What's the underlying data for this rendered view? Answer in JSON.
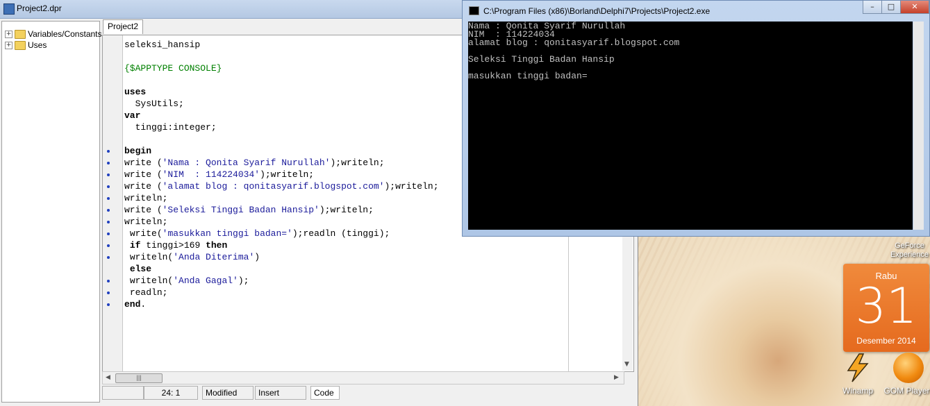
{
  "editor": {
    "title": "Project2.dpr",
    "tree": [
      {
        "toggle": "+",
        "label": "Variables/Constants"
      },
      {
        "toggle": "+",
        "label": "Uses"
      }
    ],
    "tab": "Project2",
    "code_lines": [
      "seleksi_hansip",
      "",
      "{$APPTYPE CONSOLE}",
      "",
      "uses",
      "  SysUtils;",
      "var",
      "  tinggi:integer;",
      "",
      "begin",
      "write ('Nama : Qonita Syarif Nurullah');writeln;",
      "write ('NIM  : 114224034');writeln;",
      "write ('alamat blog : qonitasyarif.blogspot.com');writeln;",
      "writeln;",
      "write ('Seleksi Tinggi Badan Hansip');writeln;",
      "writeln;",
      " write('masukkan tinggi badan=');readln (tinggi);",
      " if tinggi>169 then",
      " writeln('Anda Diterima')",
      " else",
      " writeln('Anda Gagal');",
      " readln;",
      "end."
    ],
    "hscroll_thumb": "|||",
    "status": {
      "position": "24:  1",
      "modified": "Modified",
      "mode": "Insert",
      "tab": "Code"
    }
  },
  "console": {
    "title": "C:\\Program Files (x86)\\Borland\\Delphi7\\Projects\\Project2.exe",
    "lines": [
      "Nama : Qonita Syarif Nurullah",
      "NIM  : 114224034",
      "alamat blog : qonitasyarif.blogspot.com",
      "",
      "Seleksi Tinggi Badan Hansip",
      "",
      "masukkan tinggi badan="
    ],
    "buttons": {
      "minimize": "–",
      "maximize": "□",
      "close": "✕"
    }
  },
  "desktop": {
    "calendar": {
      "day": "Rabu",
      "date": "31",
      "month": "Desember 2014"
    },
    "icons": [
      {
        "label": "GeForce Experience"
      },
      {
        "label": "Winamp"
      },
      {
        "label": "GOM Player"
      }
    ]
  },
  "colors": {
    "console_bg": "#000000",
    "console_text": "#c0c0c0",
    "calendar": "#e8702a",
    "string_blue": "#1a1a9a",
    "directive_green": "#008000"
  }
}
